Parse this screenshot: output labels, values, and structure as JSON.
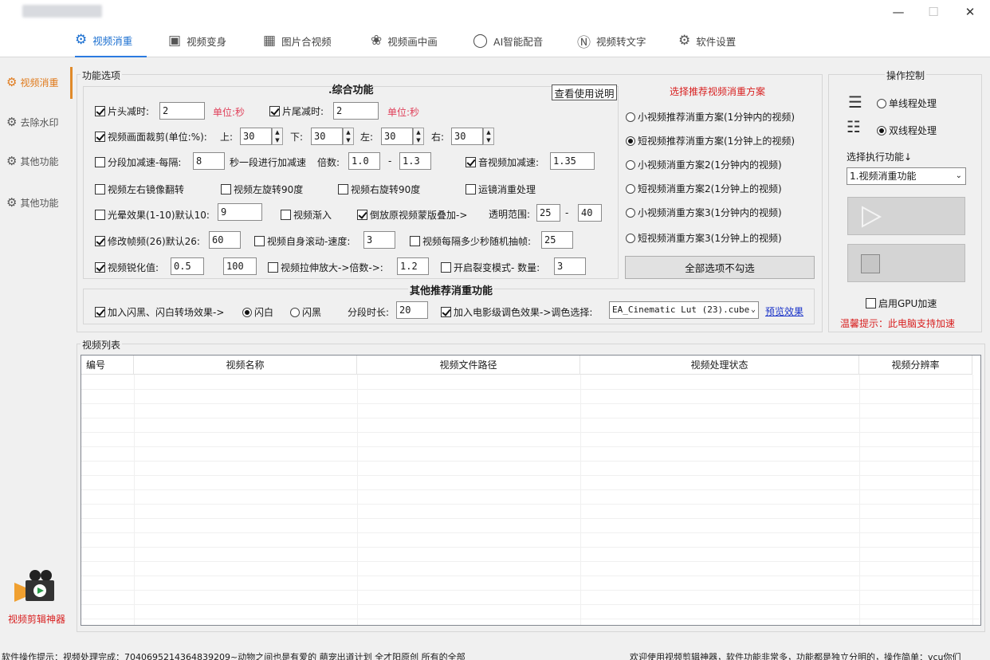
{
  "window": {
    "minimize_icon": "minimize-icon",
    "maximize_icon": "maximize-icon",
    "close_icon": "close-icon"
  },
  "tabs": [
    {
      "label": "视频消重",
      "icon": "camera-people-icon",
      "active": true
    },
    {
      "label": "视频变身",
      "icon": "video-camera-icon"
    },
    {
      "label": "图片合视频",
      "icon": "image-icon"
    },
    {
      "label": "视频画中画",
      "icon": "film-reel-icon"
    },
    {
      "label": "AI智能配音",
      "icon": "microphone-icon"
    },
    {
      "label": "视频转文字",
      "icon": "text-t-icon"
    },
    {
      "label": "软件设置",
      "icon": "gear-icon"
    }
  ],
  "sidebar": {
    "items": [
      {
        "label": "视频消重",
        "active": true
      },
      {
        "label": "去除水印"
      },
      {
        "label": "其他功能"
      },
      {
        "label": "其他功能"
      }
    ],
    "brand": "视频剪辑神器"
  },
  "features": {
    "group_label": "功能选项",
    "heading": ".综合功能",
    "help_button": "查看使用说明",
    "head_cut": {
      "label": "片头减时:",
      "checked": true,
      "value": "2",
      "unit": "单位:秒"
    },
    "tail_cut": {
      "label": "片尾减时:",
      "checked": true,
      "value": "2",
      "unit": "单位:秒"
    },
    "crop": {
      "label": "视频画面裁剪(单位:%):",
      "checked": true,
      "top_label": "上:",
      "top": "30",
      "bottom_label": "下:",
      "bottom": "30",
      "left_label": "左:",
      "left": "30",
      "right_label": "右:",
      "right": "30"
    },
    "segment_speed": {
      "label": "分段加减速-每隔:",
      "checked": false,
      "value": "8",
      "suffix": "秒一段进行加减速",
      "ratio_label": "倍数:",
      "from": "1.0",
      "dash": "-",
      "to": "1.3"
    },
    "audio_speed": {
      "label": "音视频加减速:",
      "checked": true,
      "value": "1.35"
    },
    "mirror": {
      "label": "视频左右镜像翻转",
      "checked": false
    },
    "rotate_left": {
      "label": "视频左旋转90度",
      "checked": false
    },
    "rotate_right": {
      "label": "视频右旋转90度",
      "checked": false
    },
    "motion": {
      "label": "运镜消重处理",
      "checked": false
    },
    "halo": {
      "label": "光晕效果(1-10)默认10:",
      "checked": false,
      "value": "9"
    },
    "fade_in": {
      "label": "视频渐入",
      "checked": false
    },
    "reverse_overlay": {
      "label": "倒放原视频蒙版叠加->",
      "checked": true
    },
    "opacity": {
      "label": "透明范围:",
      "from": "25",
      "dash": "-",
      "to": "40"
    },
    "framerate": {
      "label": "修改帧频(26)默认26:",
      "checked": true,
      "value": "60"
    },
    "scroll_speed": {
      "label": "视频自身滚动-速度:",
      "checked": false,
      "value": "3"
    },
    "random_frame": {
      "label": "视频每隔多少秒随机抽帧:",
      "checked": false,
      "value": "25"
    },
    "sharpen": {
      "label": "视频锐化值:",
      "checked": true,
      "value": "0.5",
      "value2": "100"
    },
    "stretch": {
      "label": "视频拉伸放大->倍数->:",
      "checked": false,
      "value": "1.2"
    },
    "split": {
      "label": "开启裂变模式- 数量:",
      "checked": false,
      "value": "3"
    }
  },
  "recommend": {
    "title": "选择推荐视频消重方案",
    "options": [
      {
        "label": "小视频推荐消重方案(1分钟内的视频)",
        "selected": false
      },
      {
        "label": "短视频推荐消重方案(1分钟上的视频)",
        "selected": true
      },
      {
        "label": "小视频消重方案2(1分钟内的视频)",
        "selected": false
      },
      {
        "label": "短视频消重方案2(1分钟上的视频)",
        "selected": false
      },
      {
        "label": "小视频消重方案3(1分钟内的视频)",
        "selected": false
      },
      {
        "label": "短视频消重方案3(1分钟上的视频)",
        "selected": false
      }
    ],
    "uncheck_all": "全部选项不勾选"
  },
  "other": {
    "heading": "其他推荐消重功能",
    "flash": {
      "label": "加入闪黑、闪白转场效果->",
      "checked": true
    },
    "flash_white": {
      "label": "闪白",
      "selected": true
    },
    "flash_black": {
      "label": "闪黑",
      "selected": false
    },
    "segment_length": {
      "label": "分段时长:",
      "value": "20"
    },
    "color_grade": {
      "label": "加入电影级调色效果->调色选择:",
      "checked": true,
      "selected": "EA_Cinematic Lut (23).cube"
    },
    "preview_link": "预览效果"
  },
  "control": {
    "group_label": "操作控制",
    "single_thread": {
      "label": "单线程处理",
      "selected": false
    },
    "multi_thread": {
      "label": "双线程处理",
      "selected": true
    },
    "exec_label": "选择执行功能↓",
    "exec_selected": "1.视频消重功能",
    "play_icon": "play-icon",
    "stop_icon": "stop-icon",
    "gpu": {
      "label": "启用GPU加速",
      "checked": false
    },
    "tip": "温馨提示：此电脑支持加速"
  },
  "video_list": {
    "label": "视频列表",
    "columns": [
      "编号",
      "视频名称",
      "视频文件路径",
      "视频处理状态",
      "视频分辨率"
    ]
  },
  "status": {
    "left": "软件操作提示：视频处理完成：7040695214364839209~动物之间也是有爱的 萌宠出道计划 全才阳原创 所有的全部",
    "right": "欢迎使用视频剪辑神器，软件功能非常多，功能都是独立分明的，操作简单：vcu你们"
  }
}
